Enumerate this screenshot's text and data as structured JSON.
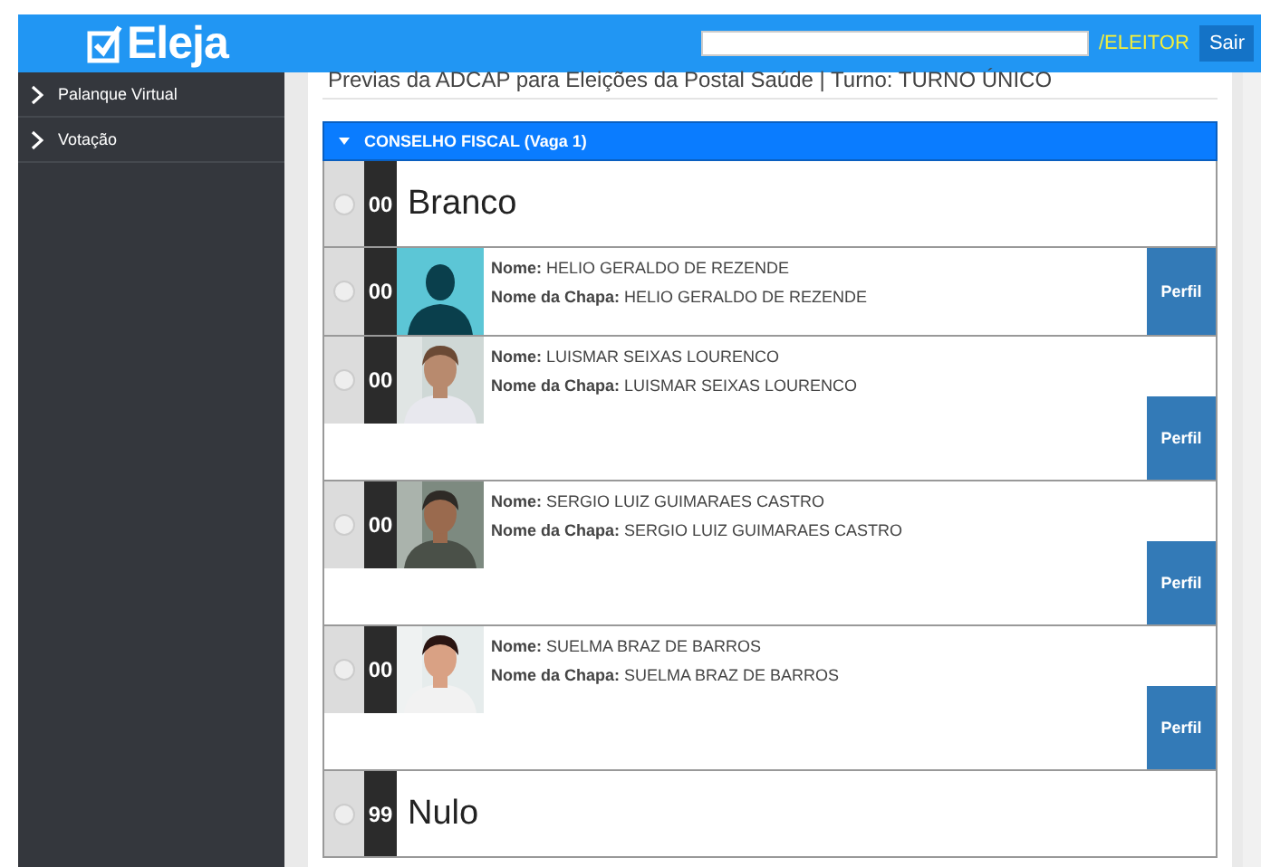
{
  "header": {
    "logo": "Eleja",
    "user": "/ELEITOR",
    "logout": "Sair"
  },
  "sidebar": {
    "items": [
      {
        "label": "Palanque Virtual"
      },
      {
        "label": "Votação"
      }
    ]
  },
  "subtitle": "Previas da ADCAP para Eleições da Postal Saúde | Turno: TURNO ÚNICO",
  "section": {
    "title": "CONSELHO FISCAL (Vaga 1)",
    "expanded": true
  },
  "options": [
    {
      "kind": "special",
      "number": "00",
      "label": "Branco",
      "selected": false
    },
    {
      "kind": "candidate",
      "number": "00",
      "compact": true,
      "name_label": "Nome:",
      "name": "HELIO GERALDO DE REZENDE",
      "slate_label": "Nome da Chapa:",
      "slate": "HELIO GERALDO DE REZENDE",
      "button": "Perfil",
      "selected": false
    },
    {
      "kind": "candidate",
      "number": "00",
      "compact": false,
      "name_label": "Nome:",
      "name": "LUISMAR SEIXAS LOURENCO",
      "slate_label": "Nome da Chapa:",
      "slate": "LUISMAR SEIXAS LOURENCO",
      "button": "Perfil",
      "selected": false
    },
    {
      "kind": "candidate",
      "number": "00",
      "compact": false,
      "name_label": "Nome:",
      "name": "SERGIO LUIZ GUIMARAES CASTRO",
      "slate_label": "Nome da Chapa:",
      "slate": "SERGIO LUIZ GUIMARAES CASTRO",
      "button": "Perfil",
      "selected": false
    },
    {
      "kind": "candidate",
      "number": "00",
      "compact": false,
      "name_label": "Nome:",
      "name": "SUELMA BRAZ DE BARROS",
      "slate_label": "Nome da Chapa:",
      "slate": "SUELMA BRAZ DE BARROS",
      "button": "Perfil",
      "selected": false
    },
    {
      "kind": "special",
      "number": "99",
      "label": "Nulo",
      "selected": false
    }
  ]
}
